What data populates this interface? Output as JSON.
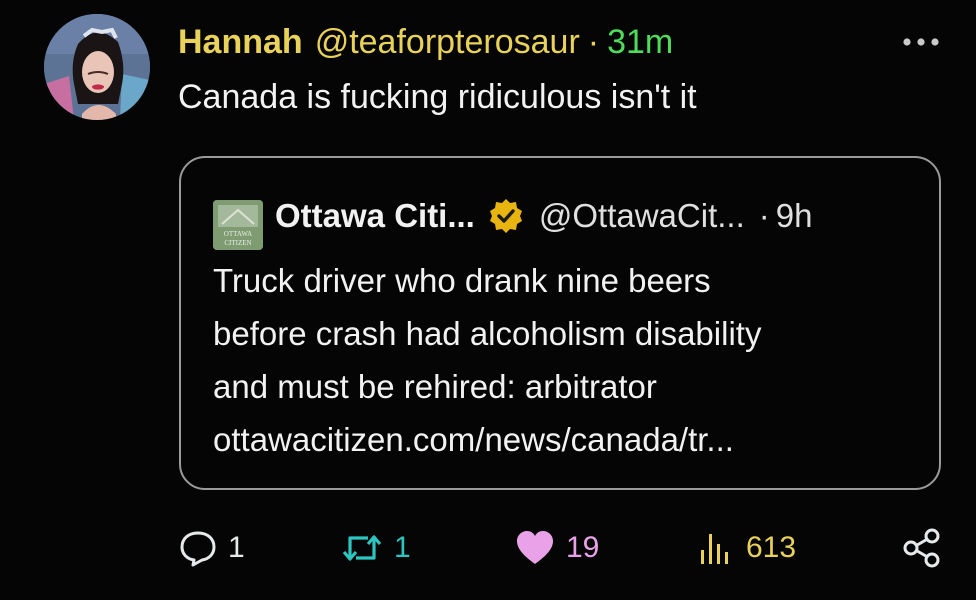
{
  "tweet": {
    "author_name": "Hannah",
    "author_handle": "@teaforpterosaur",
    "separator": "·",
    "time": "31m",
    "text": "Canada is fucking ridiculous isn't it"
  },
  "quoted": {
    "author_name": "Ottawa Citi...",
    "author_handle": "@OttawaCit...",
    "separator": "·",
    "time": "9h",
    "logo_text_line1": "OTTAWA",
    "logo_text_line2": "CITIZEN",
    "text_lines": [
      "Truck driver who drank nine beers",
      "before crash had alcoholism disability",
      "and must be rehired: arbitrator",
      "ottawacitizen.com/news/canada/tr..."
    ]
  },
  "actions": {
    "replies": "1",
    "reposts": "1",
    "likes": "19",
    "views": "613"
  },
  "colors": {
    "background": "#050505",
    "name_color": "#e8d25a",
    "time_color": "#4fdc5a",
    "repost_color": "#2ec4c0",
    "like_color": "#e9a2e8",
    "views_color": "#e8d25a",
    "verified_badge": "#e8b40f"
  },
  "icons": {
    "reply": "speech-bubble-icon",
    "repost": "repost-arrows-icon",
    "like": "heart-icon",
    "views": "bar-chart-icon",
    "share": "share-nodes-icon",
    "more": "more-dots-icon",
    "verified": "verified-badge-icon"
  }
}
